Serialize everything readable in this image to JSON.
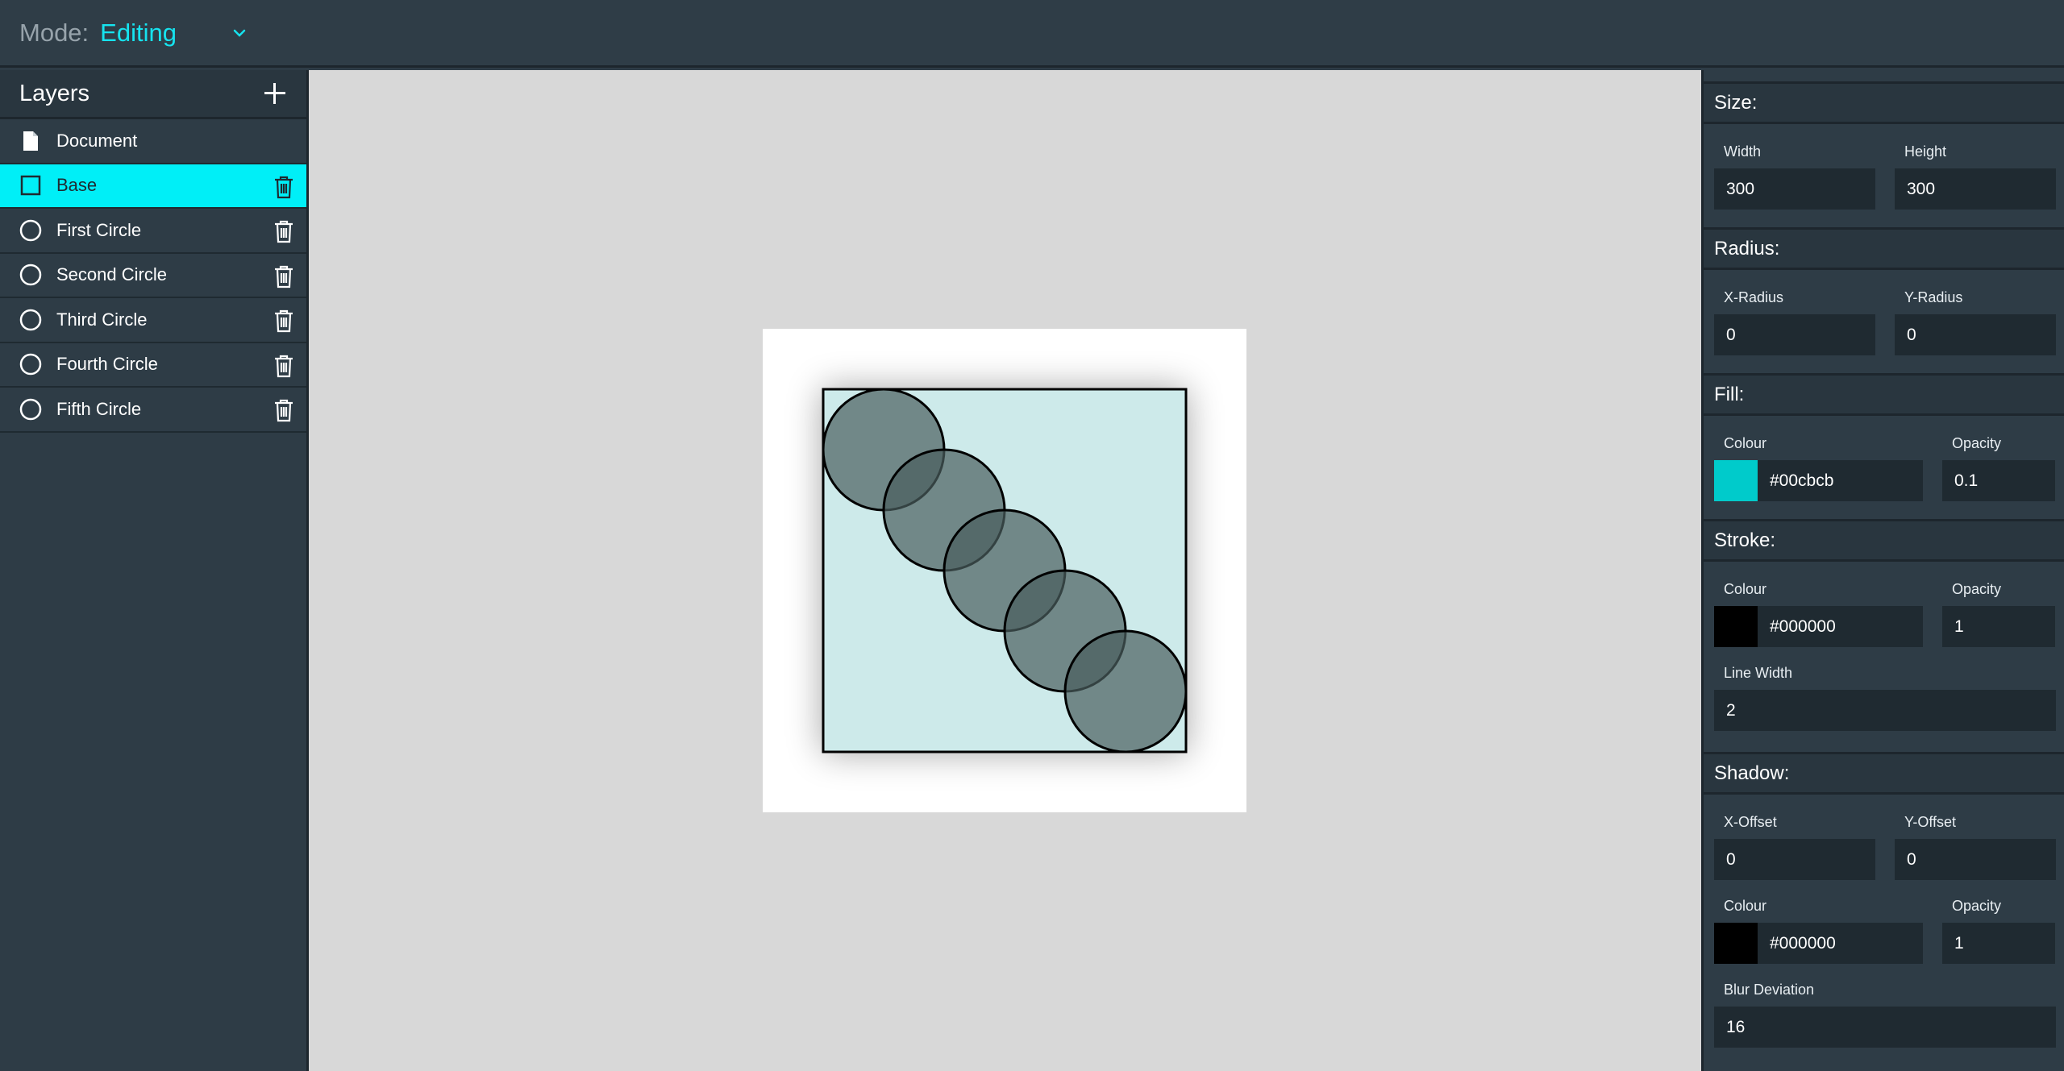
{
  "topbar": {
    "mode_label": "Mode:",
    "mode_value": "Editing"
  },
  "layers": {
    "title": "Layers",
    "items": [
      {
        "label": "Document",
        "icon": "document-icon",
        "selected": false,
        "deletable": false
      },
      {
        "label": "Base",
        "icon": "square-icon",
        "selected": true,
        "deletable": true
      },
      {
        "label": "First Circle",
        "icon": "circle-icon",
        "selected": false,
        "deletable": true
      },
      {
        "label": "Second Circle",
        "icon": "circle-icon",
        "selected": false,
        "deletable": true
      },
      {
        "label": "Third Circle",
        "icon": "circle-icon",
        "selected": false,
        "deletable": true
      },
      {
        "label": "Fourth Circle",
        "icon": "circle-icon",
        "selected": false,
        "deletable": true
      },
      {
        "label": "Fifth Circle",
        "icon": "circle-icon",
        "selected": false,
        "deletable": true
      }
    ]
  },
  "properties": {
    "size": {
      "heading": "Size:",
      "width_label": "Width",
      "width": "300",
      "height_label": "Height",
      "height": "300"
    },
    "radius": {
      "heading": "Radius:",
      "x_label": "X-Radius",
      "x": "0",
      "y_label": "Y-Radius",
      "y": "0"
    },
    "fill": {
      "heading": "Fill:",
      "colour_label": "Colour",
      "colour": "#00cbcb",
      "opacity_label": "Opacity",
      "opacity": "0.1"
    },
    "stroke": {
      "heading": "Stroke:",
      "colour_label": "Colour",
      "colour": "#000000",
      "opacity_label": "Opacity",
      "opacity": "1",
      "line_width_label": "Line Width",
      "line_width": "2"
    },
    "shadow": {
      "heading": "Shadow:",
      "x_label": "X-Offset",
      "x": "0",
      "y_label": "Y-Offset",
      "y": "0",
      "colour_label": "Colour",
      "colour": "#000000",
      "opacity_label": "Opacity",
      "opacity": "1",
      "blur_label": "Blur Deviation",
      "blur": "16"
    }
  },
  "colors": {
    "accent": "#00eff7",
    "panel": "#2e3c46",
    "canvas_bg": "#d8d8d8",
    "circle_fill": "#7a8a8a"
  }
}
